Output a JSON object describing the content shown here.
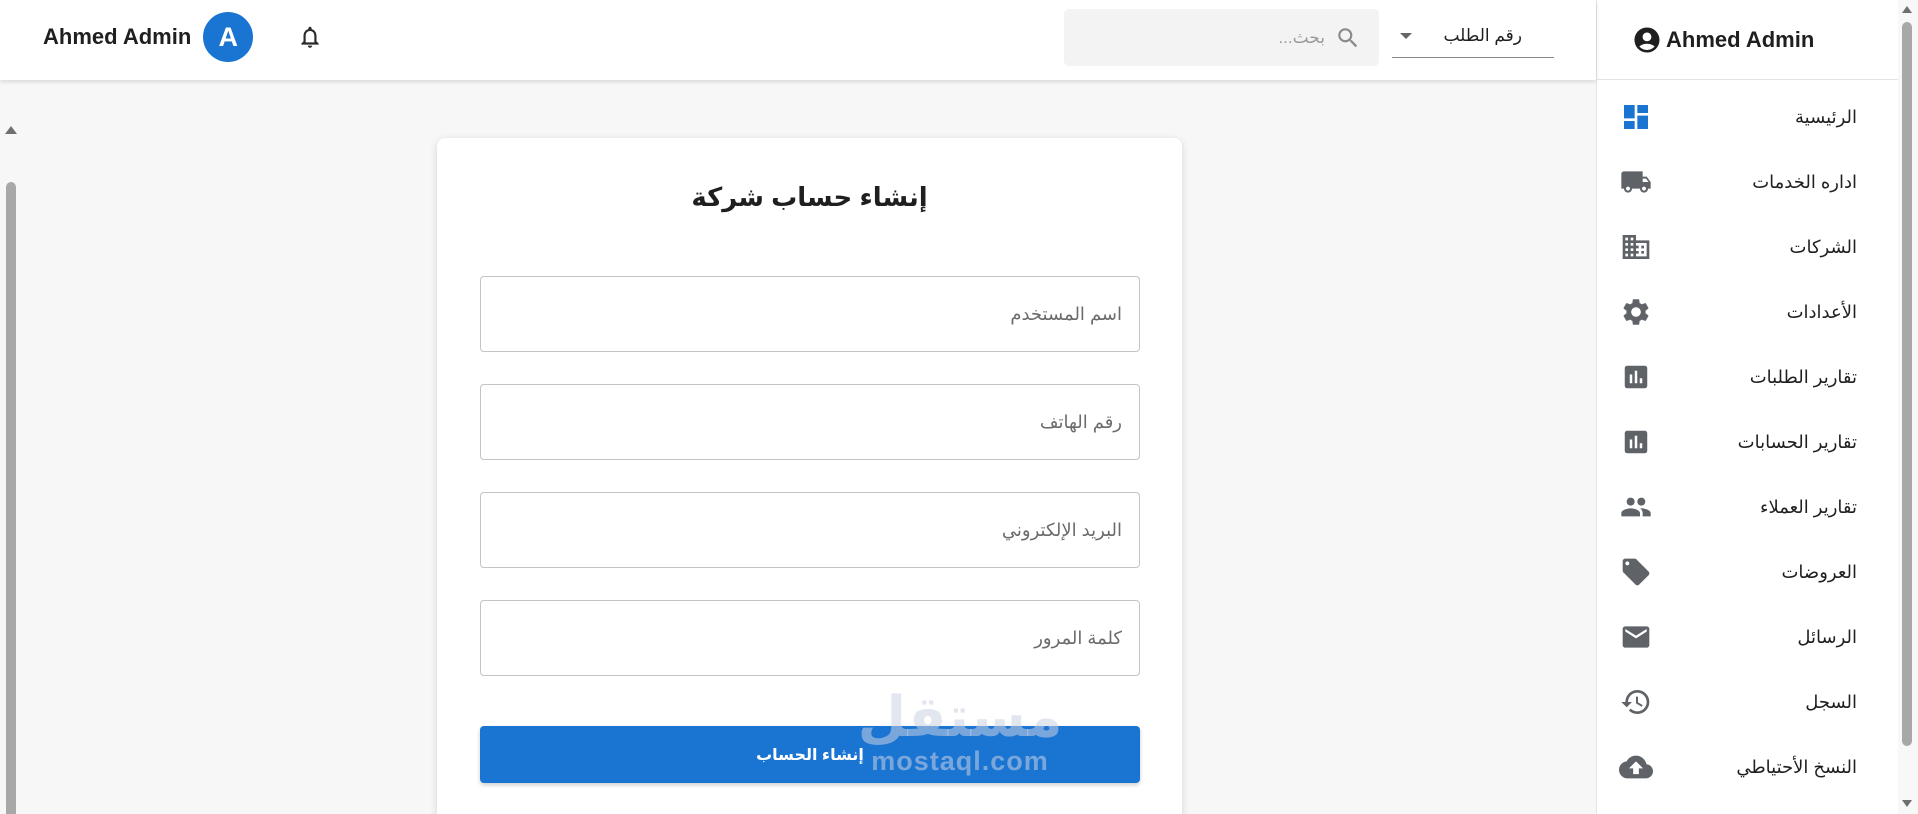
{
  "topbar": {
    "user_name": "Ahmed Admin",
    "avatar_letter": "A",
    "search_placeholder": "بحث...",
    "order_select_value": "رقم الطلب"
  },
  "sidebar": {
    "header_name": "Ahmed Admin",
    "items": [
      {
        "label": "الرئيسية",
        "icon": "dashboard-icon"
      },
      {
        "label": "اداره الخدمات",
        "icon": "truck-icon"
      },
      {
        "label": "الشركات",
        "icon": "building-icon"
      },
      {
        "label": "الأعدادات",
        "icon": "gear-icon"
      },
      {
        "label": "تقارير الطلبات",
        "icon": "bar-chart-icon"
      },
      {
        "label": "تقارير الحسابات",
        "icon": "bar-chart-icon"
      },
      {
        "label": "تقارير العملاء",
        "icon": "people-icon"
      },
      {
        "label": "العروضات",
        "icon": "tag-icon"
      },
      {
        "label": "الرسائل",
        "icon": "mail-icon"
      },
      {
        "label": "السجل",
        "icon": "history-icon"
      },
      {
        "label": "النسخ الأحتياطي",
        "icon": "cloud-upload-icon"
      }
    ]
  },
  "form": {
    "title": "إنشاء حساب شركة",
    "username_placeholder": "اسم المستخدم",
    "phone_placeholder": "رقم الهاتف",
    "email_placeholder": "البريد الإلكتروني",
    "password_placeholder": "كلمة المرور",
    "submit_label": "إنشاء الحساب"
  },
  "watermark": {
    "arabic": "مستقل",
    "latin": "mostaql.com"
  },
  "colors": {
    "primary": "#1a74d2",
    "icon_gray": "#5f6368",
    "page_bg": "#f7f7f7"
  }
}
